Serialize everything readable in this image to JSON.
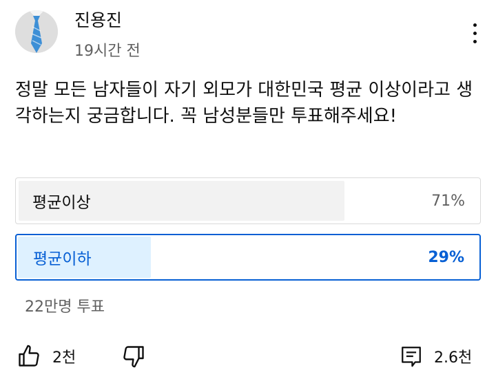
{
  "post": {
    "author": "진용진",
    "time": "19시간 전",
    "text": "정말 모든 남자들이 자기 외모가 대한민국 평균 이상이라고 생각하는지 궁금합니다. 꼭 남성분들만 투표해주세요!"
  },
  "poll": {
    "options": [
      {
        "label": "평균이상",
        "percent_label": "71%",
        "percent": 71,
        "selected": false
      },
      {
        "label": "평균이하",
        "percent_label": "29%",
        "percent": 29,
        "selected": true
      }
    ],
    "votes_label": "22만명 투표"
  },
  "actions": {
    "likes": "2천",
    "comments": "2.6천"
  },
  "icons": {
    "avatar": "tie-icon",
    "menu": "more-vert-icon",
    "like": "thumbs-up-icon",
    "dislike": "thumbs-down-icon",
    "comment": "comment-icon"
  },
  "colors": {
    "accent": "#065fd4",
    "selected_fill": "#def1ff",
    "unselected_fill": "#f2f2f2",
    "secondary_text": "#606060"
  }
}
